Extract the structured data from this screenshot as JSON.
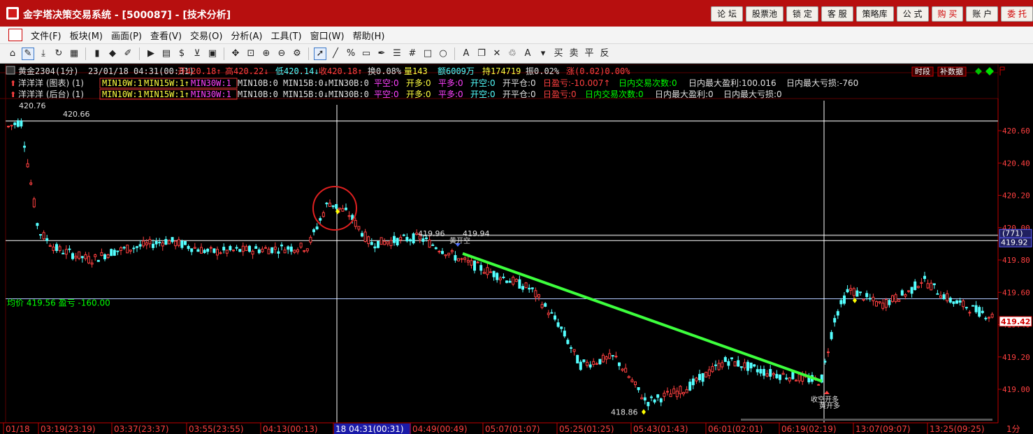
{
  "app": {
    "title": "金字塔决策交易系统 - [500087] - [技术分析]",
    "buttons": [
      "论 坛",
      "股票池",
      "锁 定",
      "客 服",
      "策略库",
      "公 式",
      "购 买",
      "账 户",
      "委 托"
    ]
  },
  "menu": [
    "文件(F)",
    "板块(M)",
    "画面(P)",
    "查看(V)",
    "交易(O)",
    "分析(A)",
    "工具(T)",
    "窗口(W)",
    "帮助(H)"
  ],
  "toolbar": {
    "icons": [
      "home-icon",
      "draw-tool-icon",
      "download-icon",
      "refresh-icon",
      "grid-icon",
      "candlestick-icon",
      "diamond-icon",
      "edit-icon",
      "play-icon",
      "report-icon",
      "dollar-icon",
      "filter-icon",
      "layout-icon",
      "move-icon",
      "zoom-fit-icon",
      "zoom-in-icon",
      "zoom-out-icon",
      "gear-icon",
      "pointer-icon",
      "line-icon",
      "percent-icon",
      "ruler-icon",
      "pen-icon",
      "hlines-icon",
      "hash-icon",
      "rect-icon",
      "circle-icon",
      "text-icon",
      "copy-icon",
      "delete-icon",
      "trash-icon",
      "color-icon",
      "save-icon"
    ],
    "labels": [
      "买",
      "卖",
      "平",
      "反"
    ]
  },
  "colors": {
    "up": "#ff4040",
    "down": "#54ffff",
    "grid": "#5a0000",
    "trend": "#3dff3d",
    "annotation": "#e02020"
  },
  "header": {
    "line1": {
      "symbol": "黄金2304(1分)",
      "datetime": "23/01/18 04:31(00:31)",
      "open": "开420.18↑",
      "high": "高420.22↓",
      "low": "低420.14↓",
      "close": "收420.18↑",
      "change_pct": "换0.08%",
      "volume": "量143",
      "amount": "额6009万",
      "hold": "持174719",
      "amplitude": "振0.02%",
      "rise": "涨(0.02)0.00%",
      "btn_period": "时段",
      "btn_fill": "补数据"
    },
    "line2": {
      "name": "洋洋洋 (图表) (1)",
      "boxed": [
        "MIN10W:1",
        "MIN15W:1↑",
        "MIN30W:1"
      ],
      "rest1": "MIN10B:0 MIN15B:0↓MIN30B:0",
      "flat_short": "平空:0",
      "open_long": "开多:0",
      "flat_long": "平多:0",
      "open_short": "开空:0",
      "open_flat": "开平仓:0",
      "day_pnl": "日盈亏:-10.007↑",
      "day_trades": "日内交易次数:0",
      "day_max_profit": "日内最大盈利:100.016",
      "day_max_loss": "日内最大亏损:-760"
    },
    "line3": {
      "name": "洋洋洋 (后台) (1)",
      "boxed": [
        "MIN10W:1",
        "MIN15W:1↑",
        "MIN30W:1"
      ],
      "rest1": "MIN10B:0 MIN15B:0↓MIN30B:0",
      "flat_short": "平空:0",
      "open_long": "开多:0",
      "flat_long": "平多:0",
      "open_short": "开空:0",
      "open_flat": "开平仓:0",
      "day_pnl": "日盈亏:0",
      "day_trades": "日内交易次数:0",
      "day_max_profit": "日内最大盈利:0",
      "day_max_loss": "日内最大亏损:0"
    }
  },
  "chart_data": {
    "type": "candlestick",
    "y_ticks": [
      "420.60",
      "420.40",
      "420.20",
      "420.00",
      "419.80",
      "419.60",
      "419.40",
      "419.20",
      "419.00"
    ],
    "price_range": [
      418.86,
      420.76
    ],
    "x_ticks": [
      "01/18",
      "03:19(23:19)",
      "03:37(23:37)",
      "03:55(23:55)",
      "04:13(00:13)",
      "18 04:31(00:31)",
      "04:49(00:49)",
      "05:07(01:07)",
      "05:25(01:25)",
      "05:43(01:43)",
      "06:01(02:01)",
      "06:19(02:19)",
      "13:07(09:07)",
      "13:25(09:25)"
    ],
    "period_label": "1分",
    "avg_price_label": "均价 419.56 盈亏 -160.00",
    "avg_price": 419.56,
    "last_price_tag": "419.42",
    "crosshair_tag_top": "(771)",
    "crosshair_tag_price": "419.92",
    "annotations": {
      "top_left": "420.76",
      "top_left2": "420.66",
      "mid": "419.96",
      "mid2": "419.94",
      "low": "418.86",
      "marker1": "黄开空",
      "marker2": "收空开多",
      "marker3": "黄开多"
    }
  }
}
